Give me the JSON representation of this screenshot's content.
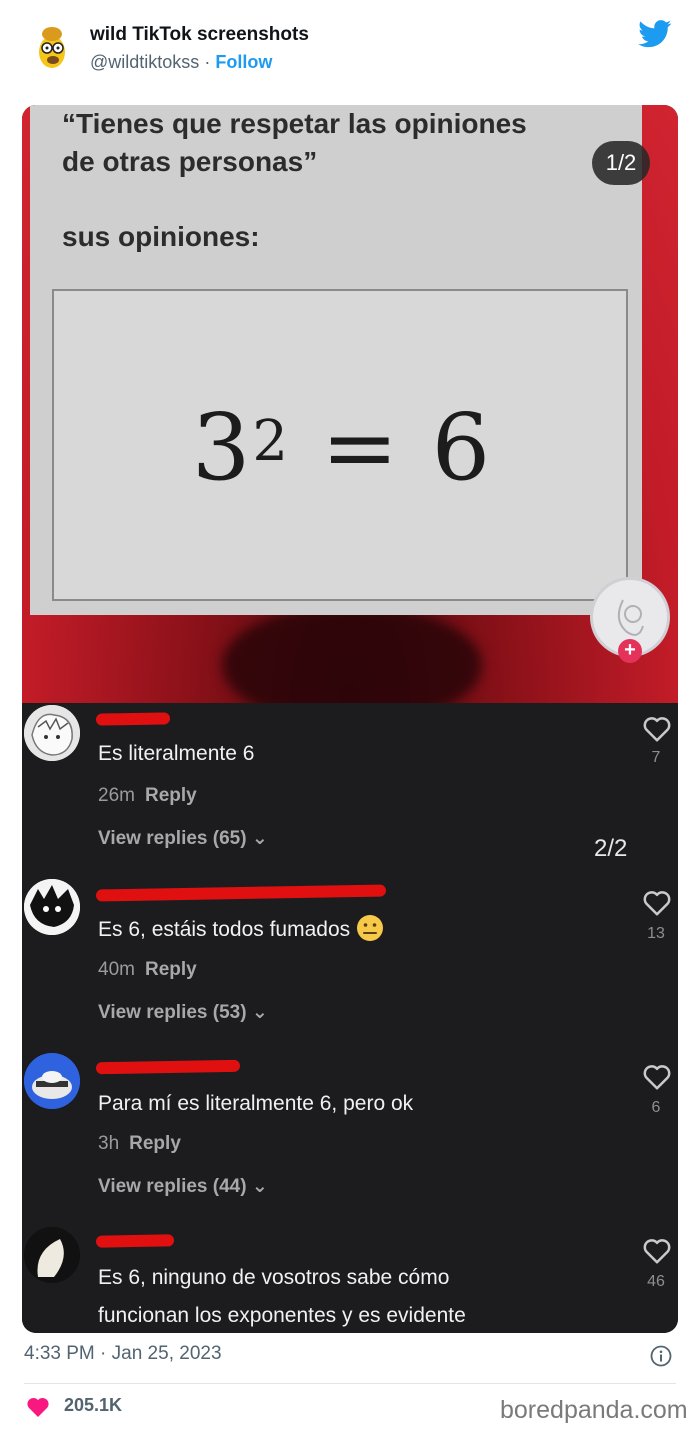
{
  "tweet": {
    "author_name": "wild TikTok screenshots",
    "author_handle": "@wildtiktokss",
    "separator": "·",
    "follow_label": "Follow",
    "timestamp": "4:33 PM · Jan 25, 2023",
    "like_count": "205.1K",
    "brand_color": "#1d9bf0",
    "like_color": "#f91880"
  },
  "media": {
    "slide1": {
      "pager": "1/2",
      "line1": "“Tienes que respetar las opiniones",
      "line2": "de otras personas”",
      "line3": "sus opiniones:",
      "equation_base": "3",
      "equation_exp": "2",
      "equation_rest": " = 6"
    },
    "slide2": {
      "pager": "2/2",
      "comments": [
        {
          "text": "Es literalmente 6",
          "time": "26m",
          "reply": "Reply",
          "replies": "View replies (65)",
          "likes": "7"
        },
        {
          "text": "Es 6, estáis todos fumados",
          "time": "40m",
          "reply": "Reply",
          "replies": "View replies (53)",
          "likes": "13"
        },
        {
          "text": "Para mí es  literalmente 6, pero ok",
          "time": "3h",
          "reply": "Reply",
          "replies": "View replies (44)",
          "likes": "6"
        },
        {
          "text_line1": "Es 6, ninguno de vosotros sabe cómo",
          "text_line2": "funcionan los exponentes y es evidente",
          "likes": "46"
        }
      ]
    }
  },
  "watermark": "boredpanda.com"
}
